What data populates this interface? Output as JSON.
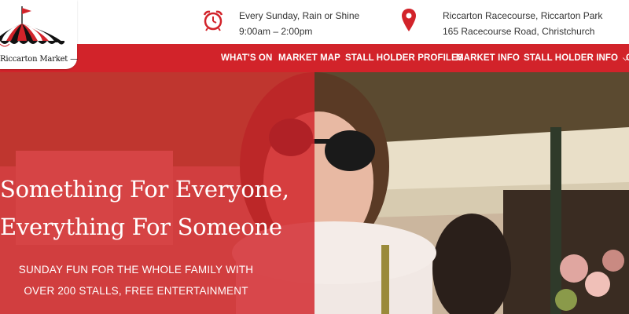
{
  "brand": {
    "logo_text": "Riccarton Market —"
  },
  "info": {
    "hours_line1": "Every Sunday, Rain or Shine",
    "hours_line2": "9:00am – 2:00pm",
    "address_line1": "Riccarton Racecourse, Riccarton Park",
    "address_line2": "165 Racecourse Road, Christchurch"
  },
  "nav": {
    "items": [
      "WHAT'S ON",
      "MARKET MAP",
      "STALL HOLDER PROFILES",
      "MARKET INFO",
      "STALL HOLDER INFO",
      "C"
    ],
    "dropdown_caret": "⌵"
  },
  "hero": {
    "headline_line1": "Something For Everyone,",
    "headline_line2": "Everything For Someone",
    "sub_line1": "SUNDAY FUN FOR THE WHOLE FAMILY WITH",
    "sub_line2": "OVER 200 STALLS, FREE ENTERTAINMENT"
  },
  "colors": {
    "brand_red": "#d2232a",
    "text_dark": "#333333"
  },
  "icons": [
    "market-tent-logo",
    "alarm-clock-icon",
    "map-pin-icon",
    "chevron-down-icon"
  ]
}
